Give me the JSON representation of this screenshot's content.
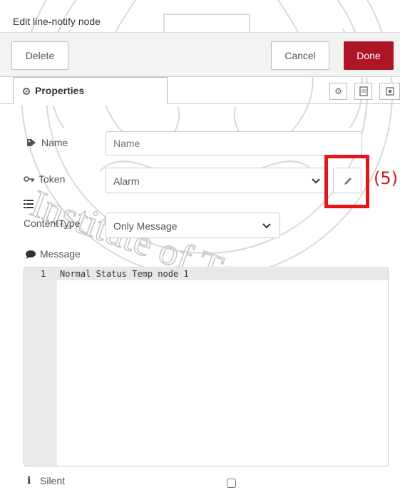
{
  "dialog": {
    "title": "Edit line-notify node"
  },
  "buttons": {
    "delete": "Delete",
    "cancel": "Cancel",
    "done": "Done"
  },
  "tabs": {
    "properties": "Properties"
  },
  "form": {
    "name_label": "Name",
    "name_placeholder": "Name",
    "token_label": "Token",
    "token_value": "Alarm",
    "content_type_label": "ContentType",
    "content_type_value": "Only Message",
    "message_label": "Message",
    "message_line_number": "1",
    "message_text": "Normal Status Temp node 1",
    "silent_label": "Silent",
    "silent_checked": false
  },
  "annotation": {
    "label": "(5)",
    "color": "#e8141a"
  },
  "watermark": {
    "text": "Institute of Technology"
  },
  "colors": {
    "done": "#ad1625",
    "accent_box": "#e8141a"
  },
  "icons": [
    "gear-icon",
    "tag-icon",
    "key-icon",
    "list-icon",
    "comment-icon",
    "info-icon",
    "pencil-icon",
    "chevron-down-icon",
    "document-icon",
    "frame-icon"
  ]
}
